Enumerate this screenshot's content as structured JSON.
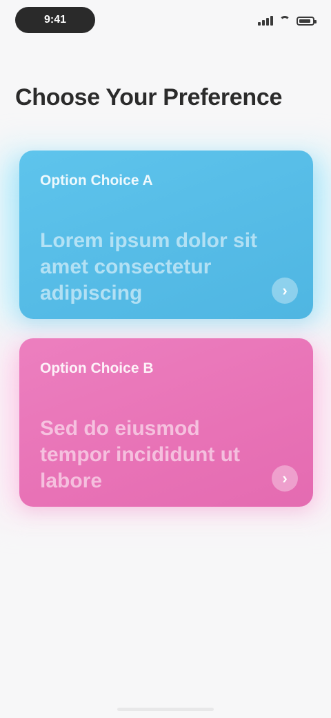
{
  "status_bar": {
    "time": "9:41"
  },
  "page": {
    "title": "Choose Your Preference"
  },
  "options": [
    {
      "label": "Option Choice A",
      "body": "Lorem ipsum dolor sit amet consectetur adipiscing",
      "arrow": "›",
      "color": "#55bbe6"
    },
    {
      "label": "Option Choice B",
      "body": "Sed do eiusmod tempor incididunt ut labore",
      "arrow": "›",
      "color": "#e872b6"
    }
  ],
  "icons": {
    "signal": "signal-icon",
    "wifi": "wifi-icon",
    "battery": "battery-icon",
    "arrow": "arrow-right-icon"
  }
}
